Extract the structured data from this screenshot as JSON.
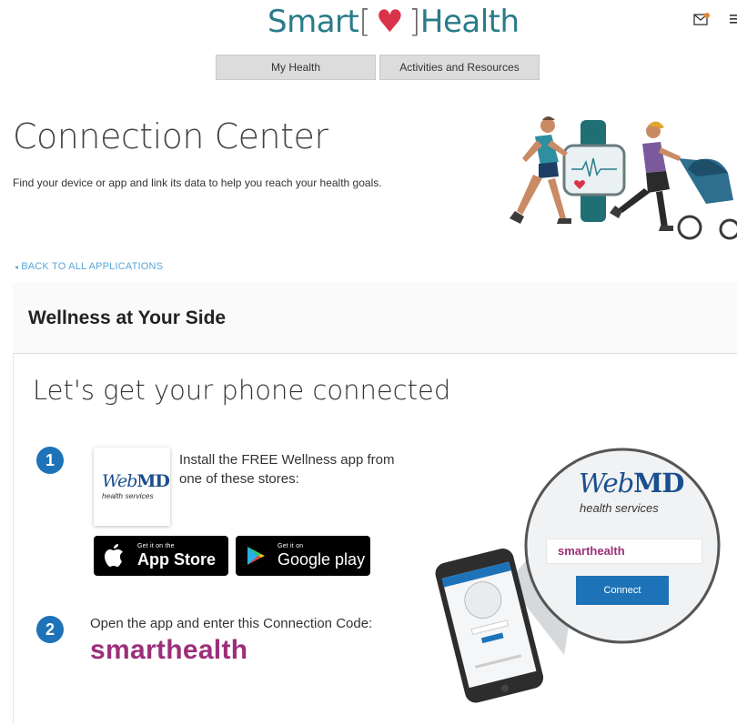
{
  "header": {
    "logo_part1": "Smart",
    "logo_bracket_open": "[",
    "logo_bracket_close": "]",
    "logo_part2": "Health",
    "tabs": [
      {
        "label": "My Health"
      },
      {
        "label": "Activities and Resources"
      }
    ],
    "icons": [
      "mail-icon",
      "menu-icon"
    ],
    "notification_dot_color": "#e8862c"
  },
  "page": {
    "title": "Connection Center",
    "subtitle": "Find your device or app and link its data to help you reach your health goals.",
    "back_link": "BACK TO ALL APPLICATIONS",
    "back_marker": "◂"
  },
  "panel": {
    "title": "Wellness at Your Side",
    "heading": "Let's get your phone connected",
    "step1": {
      "number": "1",
      "logo_web": "Web",
      "logo_md": "MD",
      "logo_sub": "health services",
      "text": "Install the FREE Wellness app from one of these stores:"
    },
    "stores": {
      "appstore_small": "Get it on the",
      "appstore_big": "App Store",
      "gplay_small": "Get it on",
      "gplay_big": "Google play"
    },
    "step2": {
      "number": "2",
      "text": "Open the app and enter this Connection Code:",
      "code": "smarthealth"
    },
    "illustration": {
      "logo_web": "Web",
      "logo_md": "MD",
      "logo_sub": "health services",
      "input_value": "smarthealth",
      "button": "Connect"
    }
  },
  "colors": {
    "brand_teal": "#2a7c8a",
    "heart_red": "#d9334a",
    "link_blue": "#5aa7d8",
    "step_blue": "#1e73b8",
    "code_magenta": "#9c2f7a"
  }
}
